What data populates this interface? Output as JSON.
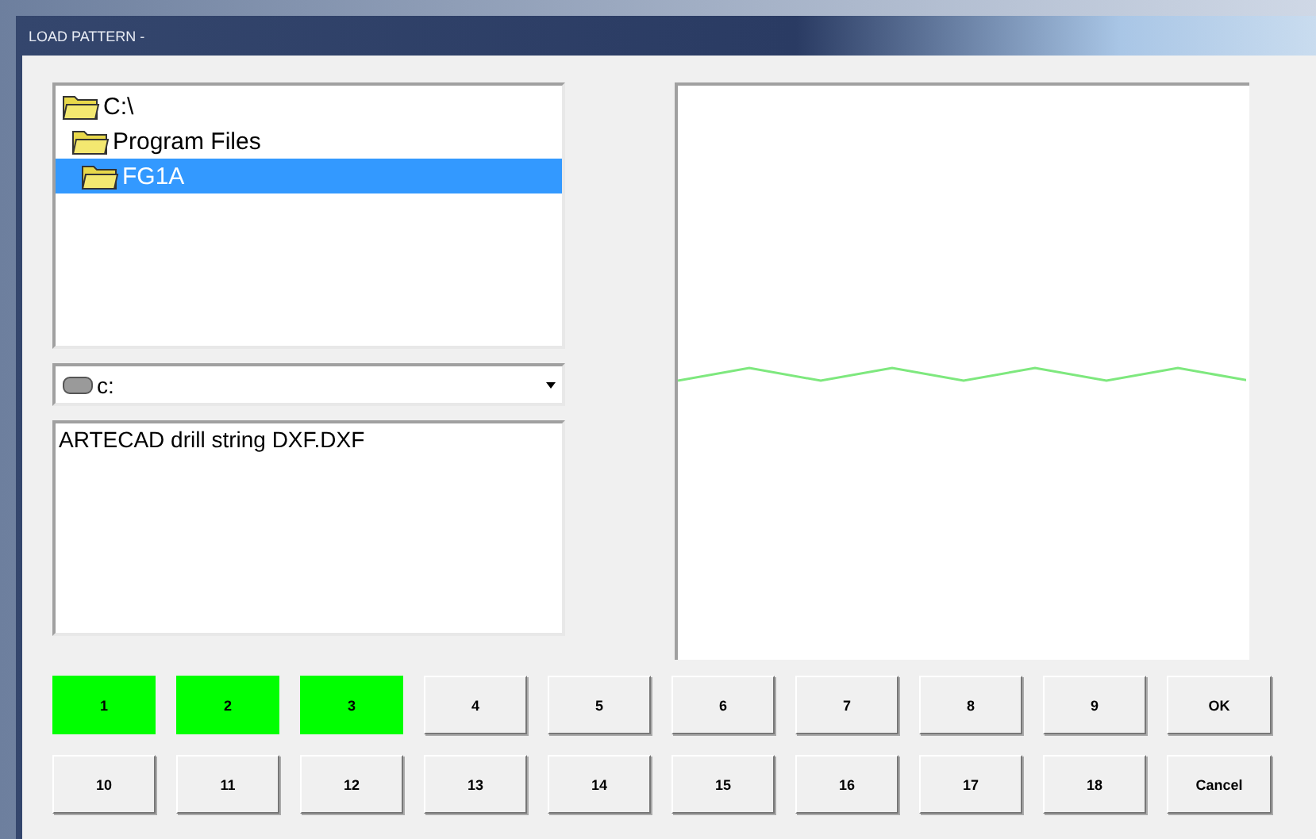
{
  "window": {
    "title": "LOAD PATTERN -"
  },
  "folders": [
    {
      "label": "C:\\",
      "selected": false,
      "children": [
        {
          "label": "Program Files",
          "selected": false,
          "children": [
            {
              "label": "FG1A",
              "selected": true
            }
          ]
        }
      ]
    }
  ],
  "drive": {
    "value": "c:"
  },
  "files": [
    {
      "label": "ARTECAD drill string DXF.DXF",
      "selected": false
    }
  ],
  "pattern_buttons": [
    {
      "label": "1",
      "selected": true
    },
    {
      "label": "2",
      "selected": true
    },
    {
      "label": "3",
      "selected": true
    },
    {
      "label": "4",
      "selected": false
    },
    {
      "label": "5",
      "selected": false
    },
    {
      "label": "6",
      "selected": false
    },
    {
      "label": "7",
      "selected": false
    },
    {
      "label": "8",
      "selected": false
    },
    {
      "label": "9",
      "selected": false
    },
    {
      "label": "10",
      "selected": false
    },
    {
      "label": "11",
      "selected": false
    },
    {
      "label": "12",
      "selected": false
    },
    {
      "label": "13",
      "selected": false
    },
    {
      "label": "14",
      "selected": false
    },
    {
      "label": "15",
      "selected": false
    },
    {
      "label": "16",
      "selected": false
    },
    {
      "label": "17",
      "selected": false
    },
    {
      "label": "18",
      "selected": false
    }
  ],
  "buttons": [
    "OK",
    "Cancel"
  ]
}
